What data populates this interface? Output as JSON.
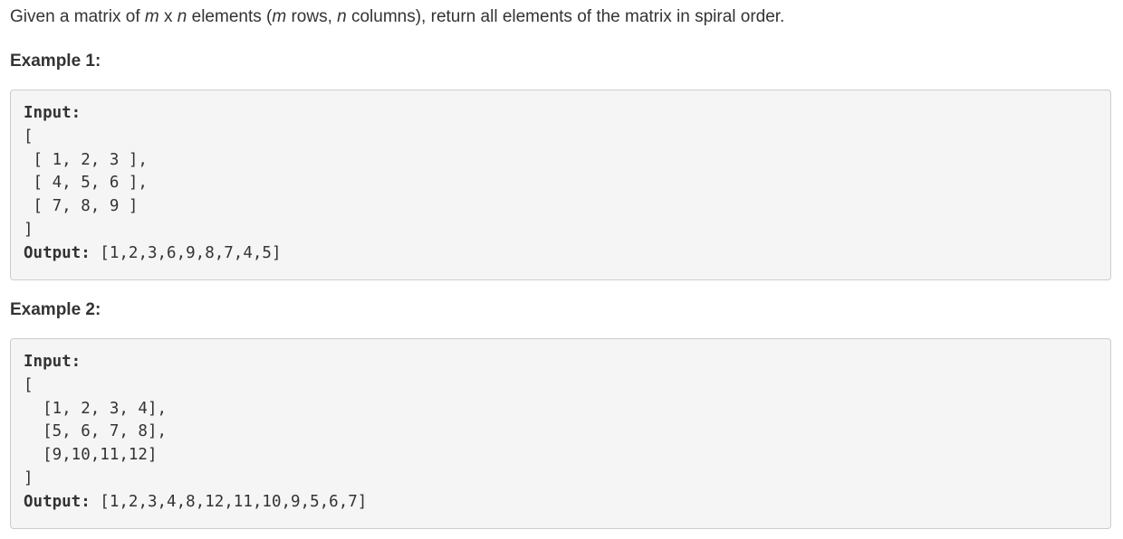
{
  "problem": {
    "part1": "Given a matrix of ",
    "var_m": "m",
    "part2": " x ",
    "var_n": "n",
    "part3": " elements (",
    "var_m2": "m",
    "part4": " rows, ",
    "var_n2": "n",
    "part5": " columns), return all elements of the matrix in spiral order."
  },
  "examples": [
    {
      "heading": "Example 1:",
      "input_label": "Input:",
      "input_lines": [
        "[",
        " [ 1, 2, 3 ],",
        " [ 4, 5, 6 ],",
        " [ 7, 8, 9 ]",
        "]"
      ],
      "output_label": "Output:",
      "output_value": " [1,2,3,6,9,8,7,4,5]"
    },
    {
      "heading": "Example 2:",
      "input_label": "Input:",
      "input_lines": [
        "[",
        "  [1, 2, 3, 4],",
        "  [5, 6, 7, 8],",
        "  [9,10,11,12]",
        "]"
      ],
      "output_label": "Output:",
      "output_value": " [1,2,3,4,8,12,11,10,9,5,6,7]"
    }
  ]
}
